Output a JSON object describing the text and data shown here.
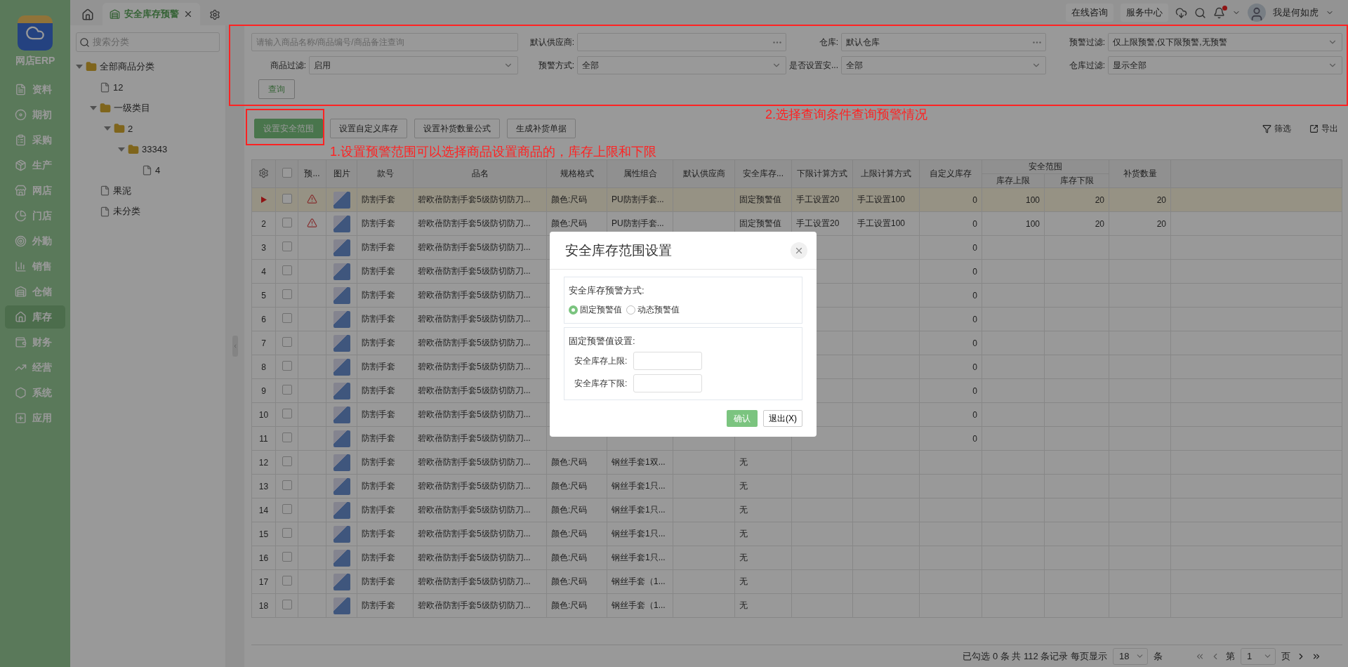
{
  "app": {
    "name": "网店ERP"
  },
  "nav": [
    {
      "label": "资料",
      "selected": false
    },
    {
      "label": "期初",
      "selected": false
    },
    {
      "label": "采购",
      "selected": false
    },
    {
      "label": "生产",
      "selected": false
    },
    {
      "label": "网店",
      "selected": false
    },
    {
      "label": "门店",
      "selected": false
    },
    {
      "label": "外勤",
      "selected": false
    },
    {
      "label": "销售",
      "selected": false
    },
    {
      "label": "仓储",
      "selected": false
    },
    {
      "label": "库存",
      "selected": true
    },
    {
      "label": "财务",
      "selected": false
    },
    {
      "label": "经营",
      "selected": false
    },
    {
      "label": "系统",
      "selected": false
    },
    {
      "label": "应用",
      "selected": false
    }
  ],
  "tabs": [
    {
      "label": "安全库存预警",
      "selected": true
    }
  ],
  "header": {
    "links": [
      "在线咨询",
      "服务中心"
    ],
    "notifications_unread": true,
    "user": "我是何如虎"
  },
  "tree": {
    "search_placeholder": "搜索分类",
    "items": [
      {
        "label": "全部商品分类",
        "kind": "folder",
        "expanded": true,
        "children": [
          {
            "label": "12",
            "kind": "file"
          },
          {
            "label": "一级类目",
            "kind": "folder",
            "expanded": true,
            "children": [
              {
                "label": "2",
                "kind": "folder",
                "expanded": true,
                "children": [
                  {
                    "label": "33343",
                    "kind": "folder",
                    "expanded": true,
                    "children": [
                      {
                        "label": "4",
                        "kind": "file"
                      }
                    ]
                  }
                ]
              }
            ]
          },
          {
            "label": "果泥",
            "kind": "file"
          },
          {
            "label": "未分类",
            "kind": "file"
          }
        ]
      }
    ]
  },
  "filters": {
    "search_placeholder": "请输入商品名称/商品编号/商品备注查询",
    "fields": [
      {
        "label": "默认供应商:",
        "kind": "picker"
      },
      {
        "label": "仓库:",
        "kind": "picker",
        "value": "默认仓库"
      },
      {
        "label": "预警过滤:",
        "kind": "select",
        "value": "仅上限预警,仅下限预警,无预警"
      },
      {
        "label": "商品过滤:",
        "kind": "select",
        "value": "启用"
      },
      {
        "label": "预警方式:",
        "kind": "select",
        "value": "全部"
      },
      {
        "label": "是否设置安...",
        "kind": "select",
        "value": "全部"
      },
      {
        "label": "仓库过滤:",
        "kind": "select",
        "value": "显示全部"
      }
    ],
    "query_button": "查询"
  },
  "toolbar": {
    "buttons": [
      {
        "label": "设置安全范围",
        "kind": "primary"
      },
      {
        "label": "设置自定义库存",
        "kind": "default"
      },
      {
        "label": "设置补货数量公式",
        "kind": "default"
      },
      {
        "label": "生成补货单据",
        "kind": "default"
      }
    ],
    "filter": "筛选",
    "export": "导出"
  },
  "annotations": [
    "2.选择查询条件查询预警情况",
    "1.设置预警范围可以选择商品设置商品的，库存上限和下限"
  ],
  "table": {
    "select_all_checked": false,
    "columns": [
      {
        "label": "预..."
      },
      {
        "label": "图片"
      },
      {
        "label": "款号"
      },
      {
        "label": "品名"
      },
      {
        "label": "规格格式"
      },
      {
        "label": "属性组合"
      },
      {
        "label": "默认供应商"
      },
      {
        "label": "安全库存..."
      },
      {
        "label": "下限计算方式"
      },
      {
        "label": "上限计算方式"
      },
      {
        "label": "自定义库存"
      },
      {
        "label": "安全范围",
        "children": [
          {
            "label": "库存上限"
          },
          {
            "label": "库存下限"
          }
        ]
      },
      {
        "label": "补货数量"
      }
    ],
    "rows": [
      {
        "selected": true,
        "checked": false,
        "warning": true,
        "code": "防割手套",
        "name": "碧欧蓓防割手套5级防切防刀...",
        "spec": "颜色:尺码",
        "attr": "PU防割手套...",
        "mode": "固定预警值",
        "lower_calc": "手工设置20",
        "upper_calc": "手工设置100",
        "custom": "0",
        "upper": "100",
        "lower": "20",
        "replenish": "20"
      },
      {
        "no": "2",
        "selected": false,
        "checked": false,
        "warning": true,
        "code": "防割手套",
        "name": "碧欧蓓防割手套5级防切防刀...",
        "spec": "颜色:尺码",
        "attr": "PU防割手套...",
        "mode": "固定预警值",
        "lower_calc": "手工设置20",
        "upper_calc": "手工设置100",
        "custom": "0",
        "upper": "100",
        "lower": "20",
        "replenish": "20"
      },
      {
        "no": "3",
        "selected": false,
        "checked": false,
        "warning": false,
        "code": "防割手套",
        "name": "碧欧蓓防割手套5级防切防刀...",
        "custom": "0"
      },
      {
        "no": "4",
        "selected": false,
        "checked": false,
        "warning": false,
        "code": "防割手套",
        "name": "碧欧蓓防割手套5级防切防刀...",
        "custom": "0"
      },
      {
        "no": "5",
        "selected": false,
        "checked": false,
        "warning": false,
        "code": "防割手套",
        "name": "碧欧蓓防割手套5级防切防刀...",
        "custom": "0"
      },
      {
        "no": "6",
        "selected": false,
        "checked": false,
        "warning": false,
        "code": "防割手套",
        "name": "碧欧蓓防割手套5级防切防刀...",
        "custom": "0"
      },
      {
        "no": "7",
        "selected": false,
        "checked": false,
        "warning": false,
        "code": "防割手套",
        "name": "碧欧蓓防割手套5级防切防刀...",
        "custom": "0"
      },
      {
        "no": "8",
        "selected": false,
        "checked": false,
        "warning": false,
        "code": "防割手套",
        "name": "碧欧蓓防割手套5级防切防刀...",
        "custom": "0"
      },
      {
        "no": "9",
        "selected": false,
        "checked": false,
        "warning": false,
        "code": "防割手套",
        "name": "碧欧蓓防割手套5级防切防刀...",
        "custom": "0"
      },
      {
        "no": "10",
        "selected": false,
        "checked": false,
        "warning": false,
        "code": "防割手套",
        "name": "碧欧蓓防割手套5级防切防刀...",
        "custom": "0"
      },
      {
        "no": "11",
        "selected": false,
        "checked": false,
        "warning": false,
        "code": "防割手套",
        "name": "碧欧蓓防割手套5级防切防刀...",
        "custom": "0"
      },
      {
        "no": "12",
        "selected": false,
        "checked": false,
        "warning": false,
        "code": "防割手套",
        "name": "碧欧蓓防割手套5级防切防刀...",
        "spec": "颜色:尺码",
        "attr": "钢丝手套1双...",
        "mode": "无"
      },
      {
        "no": "13",
        "selected": false,
        "checked": false,
        "warning": false,
        "code": "防割手套",
        "name": "碧欧蓓防割手套5级防切防刀...",
        "spec": "颜色:尺码",
        "attr": "钢丝手套1只...",
        "mode": "无"
      },
      {
        "no": "14",
        "selected": false,
        "checked": false,
        "warning": false,
        "code": "防割手套",
        "name": "碧欧蓓防割手套5级防切防刀...",
        "spec": "颜色:尺码",
        "attr": "钢丝手套1只...",
        "mode": "无"
      },
      {
        "no": "15",
        "selected": false,
        "checked": false,
        "warning": false,
        "code": "防割手套",
        "name": "碧欧蓓防割手套5级防切防刀...",
        "spec": "颜色:尺码",
        "attr": "钢丝手套1只...",
        "mode": "无"
      },
      {
        "no": "16",
        "selected": false,
        "checked": false,
        "warning": false,
        "code": "防割手套",
        "name": "碧欧蓓防割手套5级防切防刀...",
        "spec": "颜色:尺码",
        "attr": "钢丝手套1只...",
        "mode": "无"
      },
      {
        "no": "17",
        "selected": false,
        "checked": false,
        "warning": false,
        "code": "防割手套",
        "name": "碧欧蓓防割手套5级防切防刀...",
        "spec": "颜色:尺码",
        "attr": "钢丝手套（1...",
        "mode": "无"
      },
      {
        "no": "18",
        "selected": false,
        "checked": false,
        "warning": false,
        "code": "防割手套",
        "name": "碧欧蓓防割手套5级防切防刀...",
        "spec": "颜色:尺码",
        "attr": "钢丝手套（1...",
        "mode": "无"
      }
    ]
  },
  "pagination": {
    "summary": "已勾选 0 条 共 112 条记录 每页显示",
    "page_size": "18",
    "unit": "条",
    "page_prefix": "第",
    "page": "1",
    "page_suffix": "页"
  },
  "dialog": {
    "title": "安全库存范围设置",
    "mode_label": "安全库存预警方式:",
    "modes": [
      {
        "label": "固定预警值",
        "selected": true
      },
      {
        "label": "动态预警值",
        "selected": false
      }
    ],
    "fixed_label": "固定预警值设置:",
    "fields": [
      {
        "label": "安全库存上限:"
      },
      {
        "label": "安全库存下限:"
      }
    ],
    "confirm": "确认",
    "exit": "退出(X)"
  }
}
